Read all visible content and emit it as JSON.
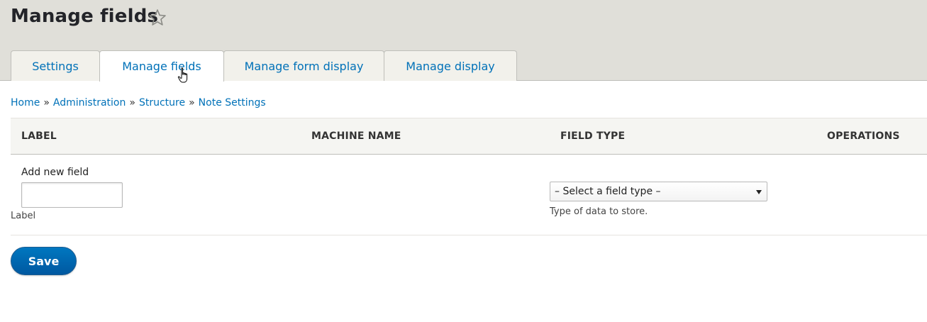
{
  "page": {
    "title": "Manage fields"
  },
  "tabs": [
    {
      "label": "Settings"
    },
    {
      "label": "Manage fields"
    },
    {
      "label": "Manage form display"
    },
    {
      "label": "Manage display"
    }
  ],
  "active_tab": "Manage fields",
  "breadcrumb": [
    {
      "label": "Home"
    },
    {
      "label": "Administration"
    },
    {
      "label": "Structure"
    },
    {
      "label": "Note Settings"
    }
  ],
  "breadcrumb_separator": "»",
  "table": {
    "headers": {
      "label": "LABEL",
      "machine_name": "MACHINE NAME",
      "field_type": "FIELD TYPE",
      "operations": "OPERATIONS"
    },
    "add_row": {
      "title": "Add new field",
      "label_input_value": "",
      "label_description": "Label",
      "field_type_selected": "– Select a field type –",
      "field_type_description": "Type of data to store."
    }
  },
  "actions": {
    "save_label": "Save"
  },
  "colors": {
    "link": "#0071b8",
    "header_bg": "#e0dfd9",
    "primary_button": "#0071b8"
  },
  "icons": {
    "favorite": "star-outline-icon",
    "cursor": "hand-pointer-icon"
  }
}
